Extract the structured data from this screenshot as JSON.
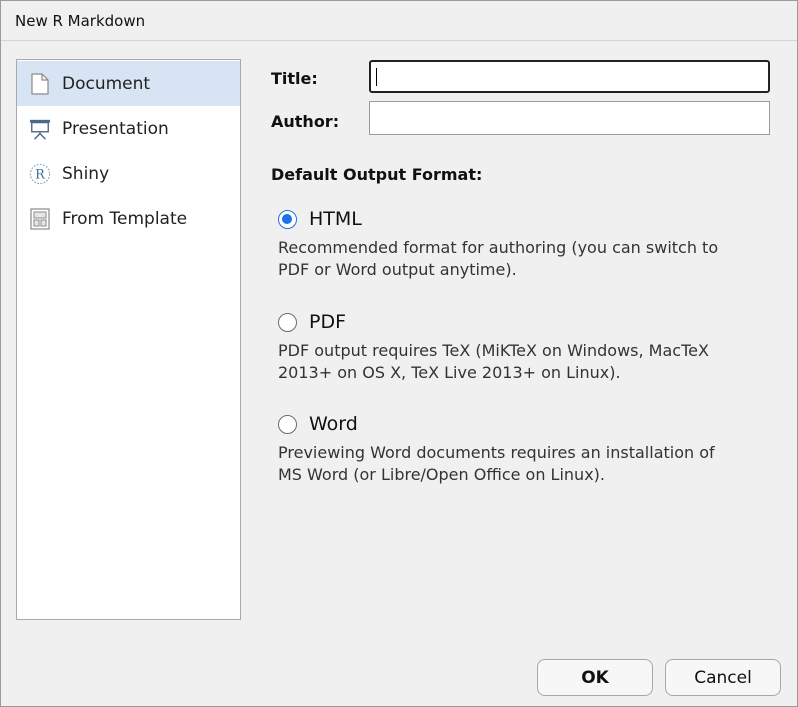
{
  "window": {
    "title": "New R Markdown"
  },
  "sidebar": {
    "items": [
      {
        "label": "Document",
        "icon": "document-icon",
        "selected": true
      },
      {
        "label": "Presentation",
        "icon": "presentation-icon",
        "selected": false
      },
      {
        "label": "Shiny",
        "icon": "shiny-r-icon",
        "selected": false
      },
      {
        "label": "From Template",
        "icon": "template-icon",
        "selected": false
      }
    ]
  },
  "form": {
    "title_label": "Title:",
    "title_value": "",
    "author_label": "Author:",
    "author_value": "",
    "default_output_label": "Default Output Format:"
  },
  "formats": [
    {
      "label": "HTML",
      "checked": true,
      "desc_line1": "Recommended format for authoring (you can switch to",
      "desc_line2": "PDF or Word output anytime)."
    },
    {
      "label": "PDF",
      "checked": false,
      "desc_line1": "PDF output requires TeX (MiKTeX on Windows, MacTeX",
      "desc_line2": "2013+ on OS X, TeX Live 2013+ on Linux)."
    },
    {
      "label": "Word",
      "checked": false,
      "desc_line1": "Previewing Word documents requires an installation of",
      "desc_line2": "MS Word (or Libre/Open Office on Linux)."
    }
  ],
  "buttons": {
    "ok": "OK",
    "cancel": "Cancel"
  },
  "colors": {
    "accent": "#1a73e8",
    "selection": "#d6e4f3"
  }
}
